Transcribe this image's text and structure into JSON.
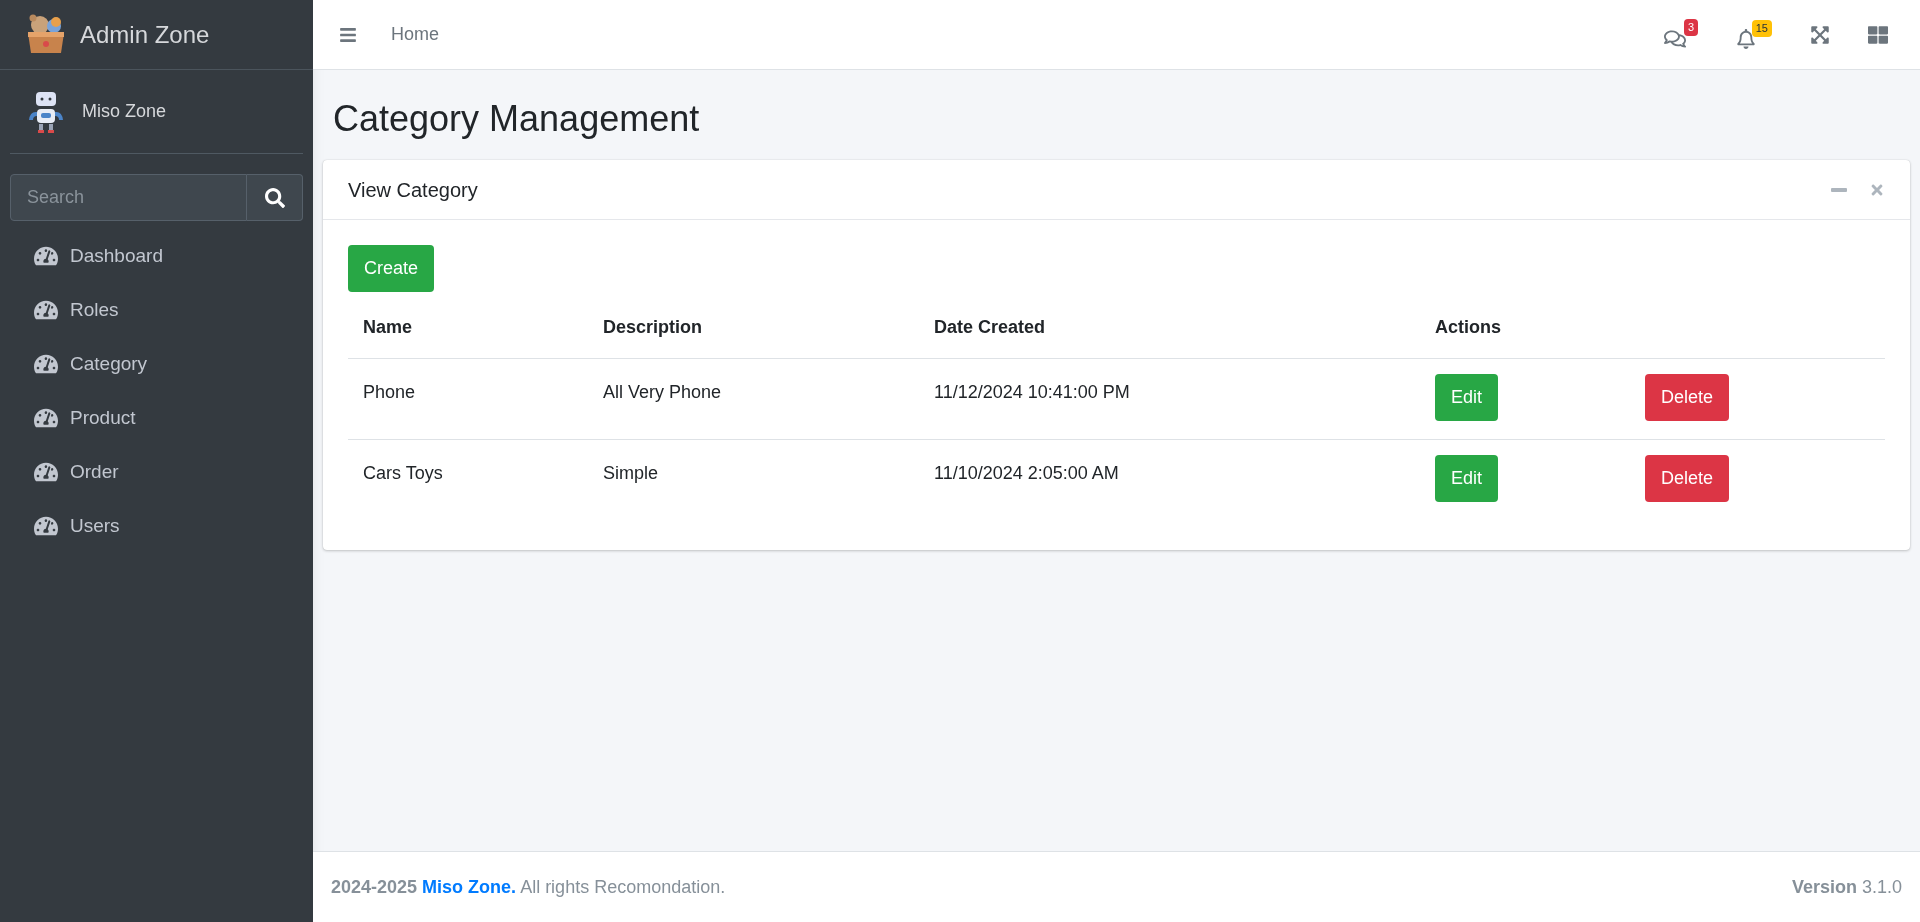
{
  "sidebar": {
    "brand": "Admin Zone",
    "user": "Miso Zone",
    "search": {
      "placeholder": "Search"
    },
    "items": [
      {
        "label": "Dashboard"
      },
      {
        "label": "Roles"
      },
      {
        "label": "Category"
      },
      {
        "label": "Product"
      },
      {
        "label": "Order"
      },
      {
        "label": "Users"
      }
    ]
  },
  "navbar": {
    "link": "Home",
    "messages_badge": "3",
    "notifications_badge": "15"
  },
  "page_title": "Category Management",
  "card": {
    "title": "View Category",
    "create_button": "Create",
    "table": {
      "columns": [
        "Name",
        "Description",
        "Date Created",
        "Actions"
      ],
      "rows": [
        {
          "name": "Phone",
          "description": "All Very Phone",
          "date": "11/12/2024 10:41:00 PM",
          "edit": "Edit",
          "delete": "Delete"
        },
        {
          "name": "Cars Toys",
          "description": "Simple",
          "date": "11/10/2024 2:05:00 AM",
          "edit": "Edit",
          "delete": "Delete"
        }
      ]
    }
  },
  "footer": {
    "years": "2024-2025",
    "link": "Miso Zone.",
    "rest": "All rights Recomondation.",
    "version_label": "Version",
    "version": "3.1.0"
  }
}
